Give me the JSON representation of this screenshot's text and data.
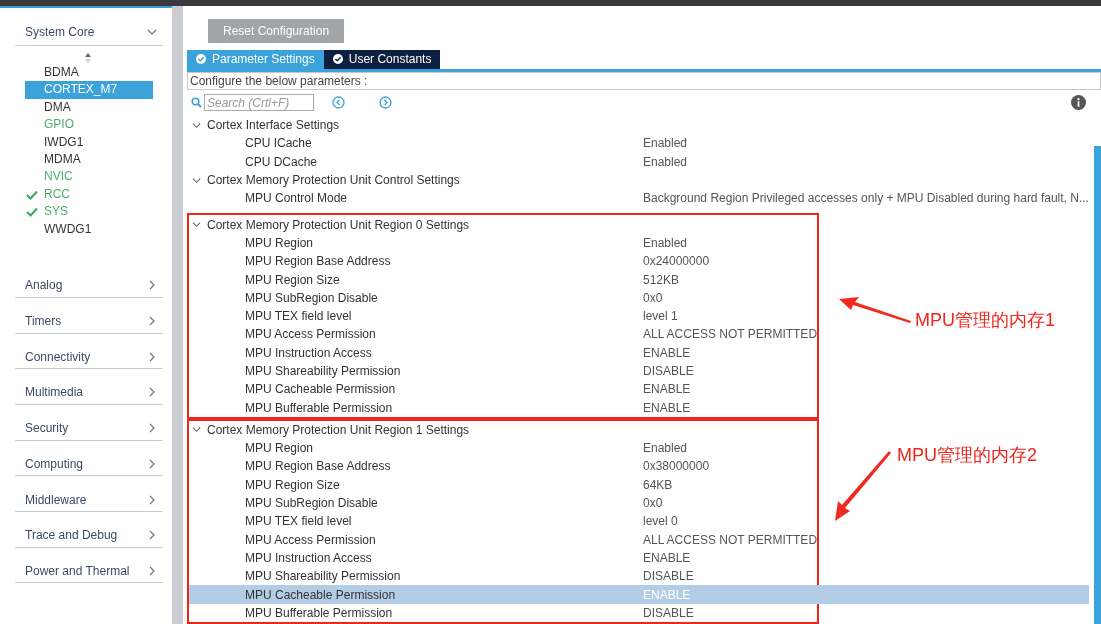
{
  "sidebar": {
    "section": {
      "label": "System Core",
      "expanded": true
    },
    "items": [
      {
        "label": "BDMA",
        "selected": false,
        "configured": false,
        "checked": false
      },
      {
        "label": "CORTEX_M7",
        "selected": true,
        "configured": false,
        "checked": false
      },
      {
        "label": "DMA",
        "selected": false,
        "configured": false,
        "checked": false
      },
      {
        "label": "GPIO",
        "selected": false,
        "configured": true,
        "checked": false
      },
      {
        "label": "IWDG1",
        "selected": false,
        "configured": false,
        "checked": false
      },
      {
        "label": "MDMA",
        "selected": false,
        "configured": false,
        "checked": false
      },
      {
        "label": "NVIC",
        "selected": false,
        "configured": true,
        "checked": false
      },
      {
        "label": "RCC",
        "selected": false,
        "configured": true,
        "checked": true
      },
      {
        "label": "SYS",
        "selected": false,
        "configured": true,
        "checked": true
      },
      {
        "label": "WWDG1",
        "selected": false,
        "configured": false,
        "checked": false
      }
    ],
    "categories": [
      {
        "label": "Analog",
        "expanded": false
      },
      {
        "label": "Timers",
        "expanded": false
      },
      {
        "label": "Connectivity",
        "expanded": false
      },
      {
        "label": "Multimedia",
        "expanded": false
      },
      {
        "label": "Security",
        "expanded": false
      },
      {
        "label": "Computing",
        "expanded": false
      },
      {
        "label": "Middleware",
        "expanded": false
      },
      {
        "label": "Trace and Debug",
        "expanded": false
      },
      {
        "label": "Power and Thermal",
        "expanded": false
      }
    ]
  },
  "reset_button": "Reset Configuration",
  "tabs": [
    {
      "label": "Parameter Settings",
      "selected": true
    },
    {
      "label": "User Constants",
      "selected": false
    }
  ],
  "hint": "Configure the below parameters :",
  "search": {
    "placeholder": "Search (Crtl+F)"
  },
  "groups": [
    {
      "title": "Cortex Interface Settings",
      "expanded": true,
      "highlighted": false,
      "params": [
        {
          "name": "CPU ICache",
          "value": "Enabled",
          "selected": false
        },
        {
          "name": "CPU DCache",
          "value": "Enabled",
          "selected": false
        }
      ]
    },
    {
      "title": "Cortex Memory Protection Unit Control Settings",
      "expanded": true,
      "highlighted": false,
      "params": [
        {
          "name": "MPU Control Mode",
          "value": "Background Region Privileged accesses only + MPU Disabled during hard fault, N...",
          "selected": false
        }
      ]
    },
    {
      "title": "Cortex Memory Protection Unit Region 0 Settings",
      "expanded": true,
      "highlighted": true,
      "annotation": {
        "label": "MPU管理的内存1",
        "kind": "arrow-left"
      },
      "params": [
        {
          "name": "MPU Region",
          "value": "Enabled",
          "selected": false
        },
        {
          "name": "MPU Region Base Address",
          "value": "0x24000000",
          "selected": false
        },
        {
          "name": "MPU Region Size",
          "value": "512KB",
          "selected": false
        },
        {
          "name": "MPU SubRegion Disable",
          "value": "0x0",
          "selected": false
        },
        {
          "name": "MPU TEX field level",
          "value": "level 1",
          "selected": false
        },
        {
          "name": "MPU Access Permission",
          "value": "ALL ACCESS NOT PERMITTED",
          "selected": false
        },
        {
          "name": "MPU Instruction Access",
          "value": "ENABLE",
          "selected": false
        },
        {
          "name": "MPU Shareability Permission",
          "value": "DISABLE",
          "selected": false
        },
        {
          "name": "MPU Cacheable Permission",
          "value": "ENABLE",
          "selected": false
        },
        {
          "name": "MPU Bufferable  Permission",
          "value": "ENABLE",
          "selected": false
        }
      ]
    },
    {
      "title": "Cortex Memory Protection Unit Region 1 Settings",
      "expanded": true,
      "highlighted": true,
      "annotation": {
        "label": "MPU管理的内存2",
        "kind": "arrow-down"
      },
      "params": [
        {
          "name": "MPU Region",
          "value": "Enabled",
          "selected": false
        },
        {
          "name": "MPU Region Base Address",
          "value": "0x38000000",
          "selected": false
        },
        {
          "name": "MPU Region Size",
          "value": "64KB",
          "selected": false
        },
        {
          "name": "MPU SubRegion Disable",
          "value": "0x0",
          "selected": false
        },
        {
          "name": "MPU TEX field level",
          "value": "level 0",
          "selected": false
        },
        {
          "name": "MPU Access Permission",
          "value": "ALL ACCESS NOT PERMITTED",
          "selected": false
        },
        {
          "name": "MPU Instruction Access",
          "value": "ENABLE",
          "selected": false
        },
        {
          "name": "MPU Shareability Permission",
          "value": "DISABLE",
          "selected": false
        },
        {
          "name": "MPU Cacheable Permission",
          "value": "ENABLE",
          "selected": true
        },
        {
          "name": "MPU Bufferable  Permission",
          "value": "DISABLE",
          "selected": false
        }
      ]
    }
  ]
}
